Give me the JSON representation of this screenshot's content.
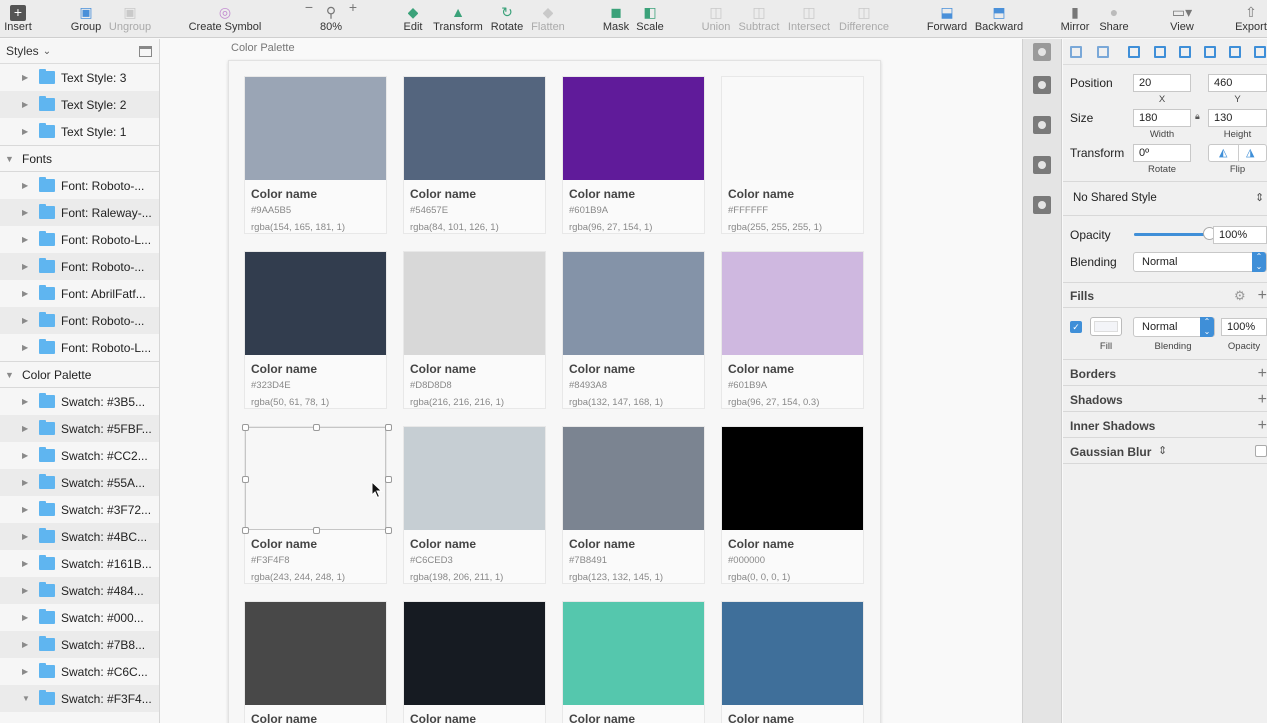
{
  "toolbar": {
    "insert": "Insert",
    "group": "Group",
    "ungroup": "Ungroup",
    "create_symbol": "Create Symbol",
    "zoom_out": "−",
    "zoom": "80%",
    "zoom_in": "+",
    "edit": "Edit",
    "transform": "Transform",
    "rotate": "Rotate",
    "flatten": "Flatten",
    "mask": "Mask",
    "scale": "Scale",
    "union": "Union",
    "subtract": "Subtract",
    "intersect": "Intersect",
    "difference": "Difference",
    "forward": "Forward",
    "backward": "Backward",
    "mirror": "Mirror",
    "share": "Share",
    "view": "View",
    "export": "Export"
  },
  "layers": {
    "header": "Styles",
    "text_styles": [
      "Text Style: 3",
      "Text Style: 2",
      "Text Style: 1"
    ],
    "fonts_section": "Fonts",
    "fonts": [
      "Font: Roboto-...",
      "Font: Raleway-...",
      "Font: Roboto-L...",
      "Font: Roboto-...",
      "Font: AbrilFatf...",
      "Font: Roboto-...",
      "Font: Roboto-L..."
    ],
    "palette_section": "Color Palette",
    "swatches": [
      "Swatch: #3B5...",
      "Swatch: #5FBF...",
      "Swatch: #CC2...",
      "Swatch: #55A...",
      "Swatch: #3F72...",
      "Swatch: #4BC...",
      "Swatch: #161B...",
      "Swatch: #484...",
      "Swatch: #000...",
      "Swatch: #7B8...",
      "Swatch: #C6C...",
      "Swatch: #F3F4..."
    ]
  },
  "canvas": {
    "artboard_title": "Color Palette",
    "swatches": [
      {
        "name": "Color name",
        "hex": "#9AA5B5",
        "rgba": "rgba(154, 165, 181, 1)",
        "color": "#9AA5B5"
      },
      {
        "name": "Color name",
        "hex": "#54657E",
        "rgba": "rgba(84, 101, 126, 1)",
        "color": "#54657E"
      },
      {
        "name": "Color name",
        "hex": "#601B9A",
        "rgba": "rgba(96, 27, 154, 1)",
        "color": "#601B9A"
      },
      {
        "name": "Color name",
        "hex": "#FFFFFF",
        "rgba": "rgba(255, 255, 255, 1)",
        "color": "#F9F9F9"
      },
      {
        "name": "Color name",
        "hex": "#323D4E",
        "rgba": "rgba(50, 61, 78, 1)",
        "color": "#323D4E"
      },
      {
        "name": "Color name",
        "hex": "#D8D8D8",
        "rgba": "rgba(216, 216, 216, 1)",
        "color": "#D8D8D8"
      },
      {
        "name": "Color name",
        "hex": "#8493A8",
        "rgba": "rgba(132, 147, 168, 1)",
        "color": "#8493A8"
      },
      {
        "name": "Color name",
        "hex": "#601B9A",
        "rgba": "rgba(96, 27, 154, 0.3)",
        "color": "#CFB8E0"
      },
      {
        "name": "Color name",
        "hex": "#F3F4F8",
        "rgba": "rgba(243, 244, 248, 1)",
        "color": "#F7F7F7"
      },
      {
        "name": "Color name",
        "hex": "#C6CED3",
        "rgba": "rgba(198, 206, 211, 1)",
        "color": "#C6CED3"
      },
      {
        "name": "Color name",
        "hex": "#7B8491",
        "rgba": "rgba(123, 132, 145, 1)",
        "color": "#7B8491"
      },
      {
        "name": "Color name",
        "hex": "#000000",
        "rgba": "rgba(0, 0, 0, 1)",
        "color": "#000000"
      },
      {
        "name": "Color name",
        "hex": "",
        "rgba": "",
        "color": "#484848"
      },
      {
        "name": "Color name",
        "hex": "",
        "rgba": "",
        "color": "#161B22"
      },
      {
        "name": "Color name",
        "hex": "",
        "rgba": "",
        "color": "#55C7AD"
      },
      {
        "name": "Color name",
        "hex": "",
        "rgba": "",
        "color": "#3F6F9A"
      }
    ]
  },
  "inspector": {
    "position_label": "Position",
    "x": "20",
    "y": "460",
    "x_label": "X",
    "y_label": "Y",
    "size_label": "Size",
    "width": "180",
    "height": "130",
    "width_label": "Width",
    "height_label": "Height",
    "transform_label": "Transform",
    "rotate_value": "0º",
    "rotate_label": "Rotate",
    "flip_label": "Flip",
    "shared_style": "No Shared Style",
    "opacity_label": "Opacity",
    "opacity_value": "100%",
    "opacity_fraction": 1.0,
    "blending_label": "Blending",
    "blending_value": "Normal",
    "fills_label": "Fills",
    "fill_label": "Fill",
    "fill_blending_value": "Normal",
    "fill_blending_label": "Blending",
    "fill_opacity_value": "100%",
    "fill_opacity_label": "Opacity",
    "borders_label": "Borders",
    "shadows_label": "Shadows",
    "inner_shadows_label": "Inner Shadows",
    "gaussian_blur_label": "Gaussian Blur"
  },
  "colors": {
    "accent": "#3F8FD8",
    "folder": "#5FB5F0"
  }
}
